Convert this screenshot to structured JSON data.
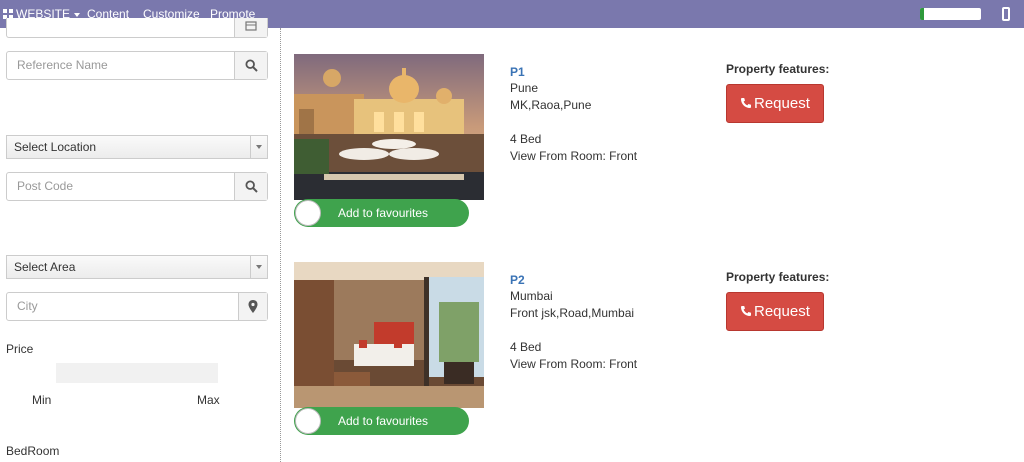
{
  "topbar": {
    "website_label": "WEBSITE",
    "menu": [
      "Content",
      "Customize",
      "Promote"
    ],
    "progress_fraction": 0.06,
    "icons": [
      "grid-icon",
      "caret-down-icon",
      "mobile-icon"
    ]
  },
  "sidebar": {
    "reference_placeholder": "Reference Name",
    "location_select": "Select Location",
    "postcode_placeholder": "Post Code",
    "area_select": "Select Area",
    "city_placeholder": "City",
    "price_label": "Price",
    "min_label": "Min",
    "max_label": "Max",
    "bedroom_label": "BedRoom",
    "icons": [
      "calendar-icon",
      "search-icon",
      "map-marker-icon"
    ]
  },
  "listings": [
    {
      "code": "P1",
      "city": "Pune",
      "address": "MK,Raoa,Pune",
      "beds": "4 Bed",
      "view": "View From Room: Front",
      "features_label": "Property features:",
      "request_label": "Request",
      "favourite_label": "Add to favourites"
    },
    {
      "code": "P2",
      "city": "Mumbai",
      "address": "Front jsk,Road,Mumbai",
      "beds": "4 Bed",
      "view": "View From Room: Front",
      "features_label": "Property features:",
      "request_label": "Request",
      "favourite_label": "Add to favourites"
    }
  ],
  "colors": {
    "topbar": "#7a78ad",
    "link_blue": "#3a73b5",
    "request_red": "#d54b43",
    "favourite_green": "#3fa34d"
  }
}
